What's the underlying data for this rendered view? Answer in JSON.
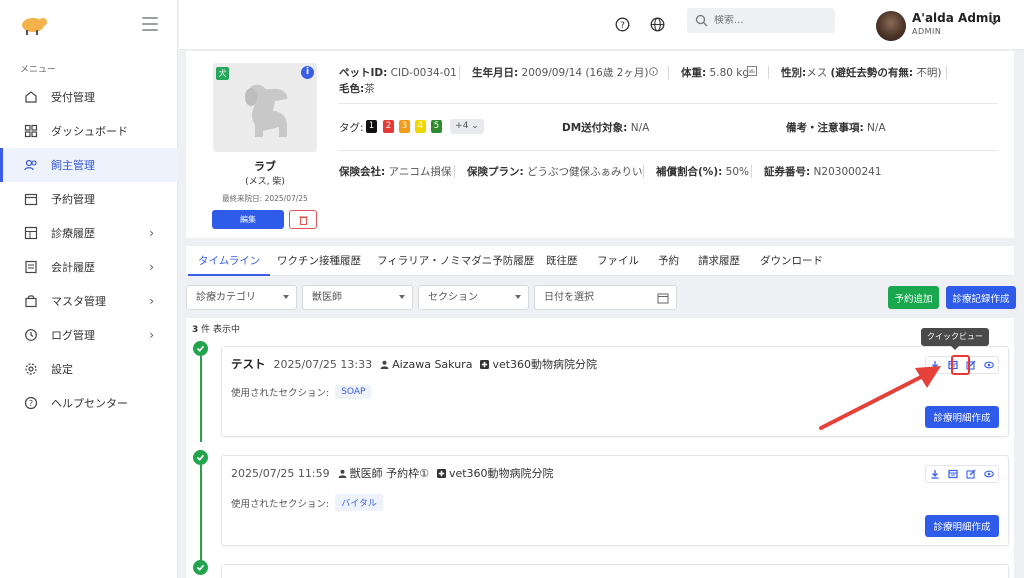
{
  "sidebar": {
    "menu_caption": "メニュー",
    "items": [
      {
        "label": "受付管理",
        "icon": "home-icon"
      },
      {
        "label": "ダッシュボード",
        "icon": "grid-icon"
      },
      {
        "label": "飼主管理",
        "icon": "users-icon",
        "active": true
      },
      {
        "label": "予約管理",
        "icon": "calendar-icon"
      },
      {
        "label": "診療履歴",
        "icon": "table-icon",
        "expandable": true
      },
      {
        "label": "会計履歴",
        "icon": "invoice-icon",
        "expandable": true
      },
      {
        "label": "マスタ管理",
        "icon": "bag-icon",
        "expandable": true
      },
      {
        "label": "ログ管理",
        "icon": "history-icon",
        "expandable": true
      },
      {
        "label": "設定",
        "icon": "gear-icon"
      },
      {
        "label": "ヘルプセンター",
        "icon": "help-icon"
      }
    ]
  },
  "topbar": {
    "search_placeholder": "検索...",
    "user_name": "A'alda Admin",
    "user_role": "ADMIN"
  },
  "pet": {
    "species_badge": "犬",
    "info_badge": "i",
    "name": "ラブ",
    "sub": "(メス, 柴)",
    "last_visit": "最終来院日: 2025/07/25",
    "edit_label": "編集",
    "pet_id_label": "ペットID:",
    "pet_id": "CID-0034-01",
    "birth_label": "生年月日:",
    "birth": "2009/09/14 (16歳 2ヶ月)",
    "weight_label": "体重:",
    "weight": "5.80 kg",
    "sex_label": "性別:",
    "sex": "メス",
    "neuter_label": "(避妊去勢の有無:",
    "neuter": "不明)",
    "coat_label": "毛色:",
    "coat": "茶",
    "tags_label": "タグ:",
    "tags": [
      {
        "text": "1",
        "color": "#111111"
      },
      {
        "text": "2",
        "color": "#e53935"
      },
      {
        "text": "3",
        "color": "#f59b1b"
      },
      {
        "text": "4",
        "color": "#f2d600"
      },
      {
        "text": "5",
        "color": "#2e8b2e"
      }
    ],
    "tags_more": "+4",
    "dm_label": "DM送付対象:",
    "dm": "N/A",
    "notes_label": "備考・注意事項:",
    "notes": "N/A",
    "insurer_label": "保険会社:",
    "insurer": "アニコム損保",
    "plan_label": "保険プラン:",
    "plan": "どうぶつ健保ふぁみりい",
    "ratio_label": "補償割合(%):",
    "ratio": "50%",
    "cert_label": "証券番号:",
    "cert": "N203000241"
  },
  "tabs": [
    "タイムライン",
    "ワクチン接種履歴",
    "フィラリア・ノミマダニ予防履歴",
    "既往歴",
    "ファイル",
    "予約",
    "請求履歴",
    "ダウンロード"
  ],
  "filters": {
    "category": "診療カテゴリ",
    "vet": "獣医師",
    "section": "セクション",
    "date": "日付を選択",
    "add_reservation": "予約追加",
    "create_record": "診療記録作成"
  },
  "timeline": {
    "count_num": "3",
    "count_text": "件 表示中",
    "tooltip": "クイックビュー",
    "sections_label": "使用されたセクション:",
    "detail_btn": "診療明細作成",
    "entries": [
      {
        "title": "テスト",
        "datetime": "2025/07/25 13:33",
        "staff": "Aizawa Sakura",
        "clinic": "vet360動物病院分院",
        "section": "SOAP"
      },
      {
        "title": "",
        "datetime": "2025/07/25 11:59",
        "staff": "獣医師 予約枠①",
        "clinic": "vet360動物病院分院",
        "section": "バイタル"
      }
    ]
  }
}
